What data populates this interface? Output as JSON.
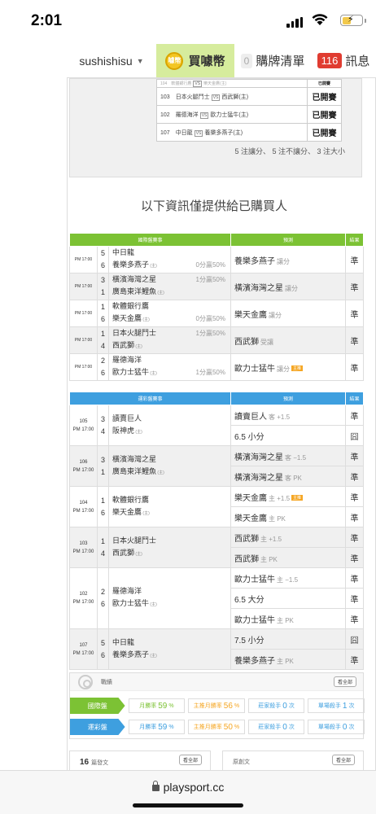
{
  "status": {
    "time": "2:01"
  },
  "nav": {
    "username": "sushishisu",
    "buy_label": "買噱幣",
    "coin_text": "噱幣",
    "cart_count": "0",
    "cart_label": "購牌清單",
    "msg_count": "116",
    "msg_label": "訊息"
  },
  "prev_table": [
    {
      "id": "104",
      "home": "軟體銀行鷹",
      "away": "樂天金鷹(主)",
      "result": "已開賽",
      "partial": true
    },
    {
      "id": "103",
      "home": "日本火腿鬥士",
      "away": "西武獅(主)",
      "result": "已開賽"
    },
    {
      "id": "102",
      "home": "羅德海洋",
      "away": "歐力士猛牛(主)",
      "result": "已開賽"
    },
    {
      "id": "107",
      "home": "中日龍",
      "away": "養樂多燕子(主)",
      "result": "已開賽"
    }
  ],
  "vs_label": "VS",
  "summary": "5 注讓分、 5 注不讓分、 3 注大小",
  "notice": "以下資訊僅提供給已購買人",
  "intl": {
    "headers": [
      "國際盤賽事",
      "預測",
      "結果"
    ],
    "home_mark": "(主)",
    "rows": [
      {
        "time": "PM 17:00",
        "n1": "5",
        "t1": "中日龍",
        "n2": "6",
        "t2": "養樂多燕子",
        "t2home": true,
        "odds": "0分贏50%",
        "oddsRow": 2,
        "pick": "養樂多燕子",
        "pickSub": "讓分",
        "result": "準"
      },
      {
        "time": "PM 17:00",
        "n1": "3",
        "t1": "橫濱海灣之星",
        "n2": "1",
        "t2": "廣島東洋鯉魚",
        "t2home": true,
        "odds": "1分贏50%",
        "oddsRow": 1,
        "pick": "橫濱海灣之星",
        "pickSub": "讓分",
        "result": "準"
      },
      {
        "time": "PM 17:00",
        "n1": "1",
        "t1": "軟體銀行鷹",
        "n2": "6",
        "t2": "樂天金鷹",
        "t2home": true,
        "odds": "0分贏50%",
        "oddsRow": 2,
        "pick": "樂天金鷹",
        "pickSub": "讓分",
        "result": "準"
      },
      {
        "time": "PM 17:00",
        "n1": "1",
        "t1": "日本火腿鬥士",
        "n2": "4",
        "t2": "西武獅",
        "t2home": true,
        "odds": "1分贏50%",
        "oddsRow": 1,
        "pick": "西武獅",
        "pickSub": "受讓",
        "result": "準"
      },
      {
        "time": "PM 17:00",
        "n1": "2",
        "t1": "羅德海洋",
        "n2": "6",
        "t2": "歐力士猛牛",
        "t2home": true,
        "odds": "1分贏50%",
        "oddsRow": 2,
        "pick": "歐力士猛牛",
        "pickSub": "讓分",
        "badge": "主推",
        "result": "準"
      }
    ]
  },
  "lottery": {
    "headers": [
      "運彩盤賽事",
      "預測",
      "結果"
    ],
    "home_mark": "(主)",
    "games": [
      {
        "id": "105",
        "time": "PM 17:00",
        "n1": "3",
        "t1": "讀賣巨人",
        "n2": "4",
        "t2": "阪神虎",
        "picks": [
          {
            "pick": "讀賣巨人",
            "sub": "客 +1.5",
            "result": "準"
          },
          {
            "pick": "6.5 小分",
            "sub": "",
            "result": "囧",
            "dark": true
          }
        ]
      },
      {
        "id": "106",
        "time": "PM 17:00",
        "n1": "3",
        "t1": "橫濱海灣之星",
        "n2": "1",
        "t2": "廣島東洋鯉魚",
        "picks": [
          {
            "pick": "橫濱海灣之星",
            "sub": "客 −1.5",
            "result": "準"
          },
          {
            "pick": "橫濱海灣之星",
            "sub": "客 PK",
            "result": "準"
          }
        ]
      },
      {
        "id": "104",
        "time": "PM 17:00",
        "n1": "1",
        "t1": "軟體銀行鷹",
        "n2": "6",
        "t2": "樂天金鷹",
        "picks": [
          {
            "pick": "樂天金鷹",
            "sub": "主 +1.5",
            "badge": "主推",
            "result": "準"
          },
          {
            "pick": "樂天金鷹",
            "sub": "主 PK",
            "result": "準"
          }
        ]
      },
      {
        "id": "103",
        "time": "PM 17:00",
        "n1": "1",
        "t1": "日本火腿鬥士",
        "n2": "4",
        "t2": "西武獅",
        "picks": [
          {
            "pick": "西武獅",
            "sub": "主 +1.5",
            "result": "準"
          },
          {
            "pick": "西武獅",
            "sub": "主 PK",
            "result": "準"
          }
        ]
      },
      {
        "id": "102",
        "time": "PM 17:00",
        "n1": "2",
        "t1": "羅德海洋",
        "n2": "6",
        "t2": "歐力士猛牛",
        "picks": [
          {
            "pick": "歐力士猛牛",
            "sub": "主 −1.5",
            "result": "準"
          },
          {
            "pick": "6.5 大分",
            "sub": "",
            "result": "準"
          },
          {
            "pick": "歐力士猛牛",
            "sub": "主 PK",
            "result": "準"
          }
        ]
      },
      {
        "id": "107",
        "time": "PM 17:00",
        "n1": "5",
        "t1": "中日龍",
        "n2": "6",
        "t2": "養樂多燕子",
        "picks": [
          {
            "pick": "7.5 小分",
            "sub": "",
            "result": "囧",
            "dark": true
          },
          {
            "pick": "養樂多燕子",
            "sub": "主 PK",
            "result": "準"
          }
        ]
      }
    ]
  },
  "record": {
    "title": "戰績",
    "see_all": "看全部",
    "rows": [
      {
        "label": "國際盤",
        "color": "#7cc234",
        "stats": [
          {
            "k": "月勝率",
            "v": "59",
            "u": "%",
            "c": "#7cc234"
          },
          {
            "k": "主推月勝率",
            "v": "56",
            "u": "%",
            "c": "#f5a623"
          },
          {
            "k": "莊家殺手",
            "v": "0",
            "u": "次",
            "c": "#3e9fdf"
          },
          {
            "k": "單場殺手",
            "v": "1",
            "u": "次",
            "c": "#3e9fdf"
          }
        ]
      },
      {
        "label": "運彩盤",
        "color": "#3e9fdf",
        "stats": [
          {
            "k": "月勝率",
            "v": "59",
            "u": "%",
            "c": "#3e9fdf"
          },
          {
            "k": "主推月勝率",
            "v": "50",
            "u": "%",
            "c": "#f5a623"
          },
          {
            "k": "莊家殺手",
            "v": "0",
            "u": "次",
            "c": "#3e9fdf"
          },
          {
            "k": "單場殺手",
            "v": "0",
            "u": "次",
            "c": "#3e9fdf"
          }
        ]
      }
    ]
  },
  "bottom_boxes": [
    {
      "num": "16",
      "label": "篇發文",
      "btn": "看全部"
    },
    {
      "num": "",
      "label": "原創文",
      "btn": "看全部"
    }
  ],
  "browser": {
    "url": "playsport.cc"
  }
}
